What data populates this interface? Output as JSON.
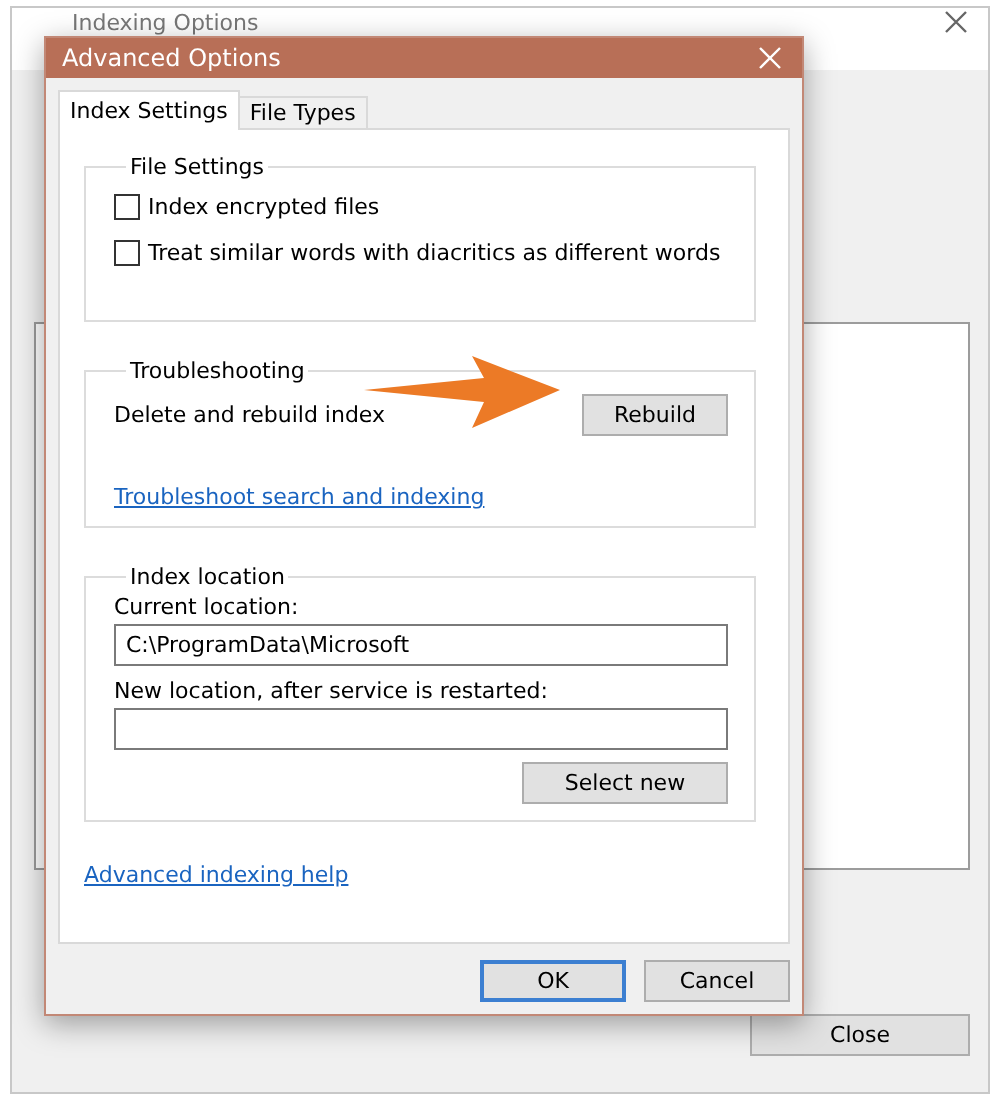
{
  "background_window": {
    "title": "Indexing Options",
    "close_button": "Close"
  },
  "dialog": {
    "title": "Advanced Options",
    "tabs": [
      {
        "label": "Index Settings",
        "selected": true
      },
      {
        "label": "File Types",
        "selected": false
      }
    ],
    "file_settings": {
      "title": "File Settings",
      "options": [
        {
          "label": "Index encrypted files",
          "checked": false
        },
        {
          "label": "Treat similar words with diacritics as different words",
          "checked": false
        }
      ]
    },
    "troubleshooting": {
      "title": "Troubleshooting",
      "action_label": "Delete and rebuild index",
      "button": "Rebuild",
      "link": "Troubleshoot search and indexing"
    },
    "index_location": {
      "title": "Index location",
      "current_label": "Current location:",
      "current_value": "C:\\ProgramData\\Microsoft",
      "new_label": "New location, after service is restarted:",
      "button": "Select new"
    },
    "help_link": "Advanced indexing help",
    "buttons": [
      {
        "label": "OK",
        "default": true
      },
      {
        "label": "Cancel",
        "default": false
      }
    ]
  }
}
